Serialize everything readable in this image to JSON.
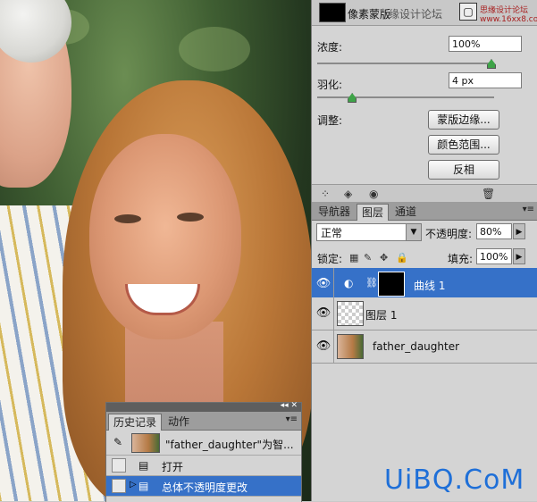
{
  "masks_panel": {
    "title": "像素蒙版",
    "title_overlay": "缘设计论坛",
    "site_overlay": "思缘设计论坛 www.16xx8.com",
    "density_label": "浓度:",
    "density_value": "100%",
    "density_slider": 1.0,
    "feather_label": "羽化:",
    "feather_value": "4 px",
    "feather_slider": 0.18,
    "adjust_label": "调整:",
    "buttons": [
      "蒙版边缘...",
      "颜色范围...",
      "反相"
    ]
  },
  "layers_panel": {
    "tabs": [
      "导航器",
      "图层",
      "通道"
    ],
    "active_tab": "图层",
    "blend_mode": "正常",
    "opacity_label": "不透明度:",
    "opacity_value": "80%",
    "lock_label": "锁定:",
    "fill_label": "填充:",
    "fill_value": "100%",
    "layers": [
      {
        "name": "曲线 1",
        "selected": true
      },
      {
        "name": "图层 1",
        "selected": false
      },
      {
        "name": "father_daughter",
        "selected": false
      }
    ]
  },
  "history_panel": {
    "tabs": [
      "历史记录",
      "动作"
    ],
    "active_tab": "历史记录",
    "snapshot": "\"father_daughter\"为智...",
    "items": [
      {
        "label": "打开",
        "selected": false
      },
      {
        "label": "总体不透明度更改",
        "selected": true
      }
    ]
  },
  "watermark": "UiBQ.CoM",
  "colors": {
    "selection": "#3671c8",
    "panel": "#d4d4d4",
    "watermark": "#1e6fd8"
  }
}
